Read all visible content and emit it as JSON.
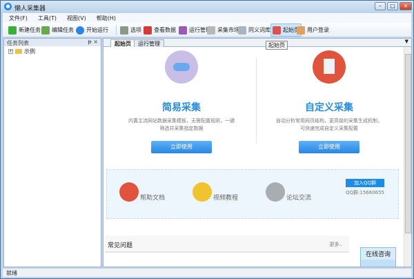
{
  "window": {
    "title": "懒人采集器",
    "app_icon": "app-logo-icon"
  },
  "menu": [
    "文件(F)",
    "工具(T)",
    "视图(V)",
    "帮助(H)"
  ],
  "toolbar": [
    {
      "label": "新建任务",
      "icon": "new-task-icon",
      "color": "#3cae3a"
    },
    {
      "label": "编辑任务",
      "icon": "edit-task-icon",
      "color": "#6aa84f"
    },
    {
      "label": "开始运行",
      "icon": "play-icon",
      "color": "#2a86e2"
    },
    {
      "label": "选项",
      "icon": "gear-icon",
      "color": "#8a9a86"
    },
    {
      "label": "查看数据",
      "icon": "book-icon",
      "color": "#d33a3a"
    },
    {
      "label": "运行管理",
      "icon": "database-icon",
      "color": "#9b59b6"
    },
    {
      "label": "采集市场",
      "icon": "market-icon",
      "color": "#b8b8b8"
    },
    {
      "label": "同义词库",
      "icon": "document-icon",
      "color": "#aab4c0"
    },
    {
      "label": "起始页",
      "icon": "home-icon",
      "color": "#d9534f",
      "active": true
    },
    {
      "label": "用户登录",
      "icon": "user-icon",
      "color": "#e0a060"
    }
  ],
  "tooltip": "起始页",
  "left_panel": {
    "title": "任务列表",
    "pin": "ᵽ",
    "close": "×",
    "tree": [
      {
        "label": "示例",
        "expand": "+"
      }
    ]
  },
  "tabs": [
    {
      "label": "起始页",
      "active": true
    },
    {
      "label": "运行管理"
    }
  ],
  "cards": [
    {
      "title": "简易采集",
      "desc": "内置主流网站数据采集模板，无需配置规则，一键筛选并采集指定数据",
      "button": "立即使用",
      "icon": "cloud-icon",
      "color": "#c9bfe6"
    },
    {
      "title": "自定义采集",
      "desc": "自动分析常用网页结构，更高级的采集生成机制，可快速完成自定义采集配置",
      "button": "立即使用",
      "icon": "document-icon",
      "color": "#e0533d"
    }
  ],
  "help": [
    {
      "label": "帮助文档",
      "icon": "document-icon",
      "color": "#e0533d"
    },
    {
      "label": "视频教程",
      "icon": "video-camera-icon",
      "color": "#f0c330"
    },
    {
      "label": "论坛交流",
      "icon": "people-icon",
      "color": "#a9adb2"
    }
  ],
  "qq": {
    "button": "加入QQ群",
    "number": "QQ群:15660655"
  },
  "faq": {
    "title": "常见问题",
    "more": "更多.."
  },
  "consult": "在线咨询",
  "status": "就绪"
}
